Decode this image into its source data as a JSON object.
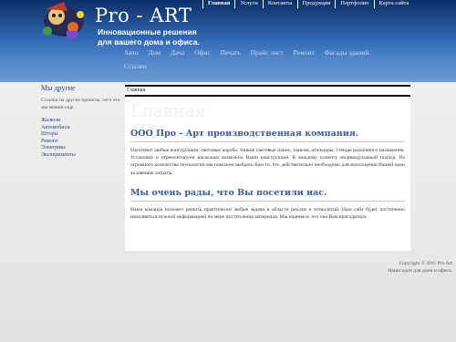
{
  "header": {
    "site_title": "Pro - ART",
    "slogan": "Инновационные решения для вашего дома и офиса.",
    "top_nav": [
      "Главная",
      "Услуги",
      "Контакты",
      "Продукция",
      "Портфолио",
      "Карта сайта"
    ],
    "main_nav": [
      "Авто",
      "Дом",
      "Дача",
      "Офис",
      "Печать",
      "Прайс лист",
      "Ремонт",
      "Фасады зданий",
      "Ссылки"
    ]
  },
  "sidebar": {
    "title": "Мы другие",
    "text": "Ссылки на другие проекты, того что мы можем еще.",
    "links": [
      "Жалюзи",
      "Автомобили",
      "Шторы",
      "Ремонт",
      "Электрика",
      "Эксперименты"
    ]
  },
  "content": {
    "breadcrumb": "Главная",
    "page_heading": "Главная",
    "heading1": "ООО Про - Арт производственная компания.",
    "para1": "Изготовит любые конструкции, световые короба, тонкие световые панно, панели, штендеры, стенды различного назначения. Установки и отремонтируем насколько возможно Ваши конструкции. К каждому клиенту индивидуальный подход. Из огромного количества технологии мы поможем выбрать Вам то, что действительно необходимо для воплощения Вашей идеи за завешие затраты.",
    "heading2": "Мы очень рады, что Вы посетили нас.",
    "para2": "Наша команда поможет решить практически любые задачи в области реклам и технологий. Наш сайт будет постепенно наполняться нужной информацией по мере поступления материала. Мы надеемся, что она Вам пригодиться."
  },
  "footer": {
    "copyright": "Copyright © 2011 Pro Art",
    "tagline": "Наши идеи для дома и офиса."
  },
  "colors": {
    "header_dark": "#0d2f66",
    "header_light": "#6d9bd6",
    "heading_blue": "#3a5c93",
    "link_blue": "#284b8c"
  }
}
